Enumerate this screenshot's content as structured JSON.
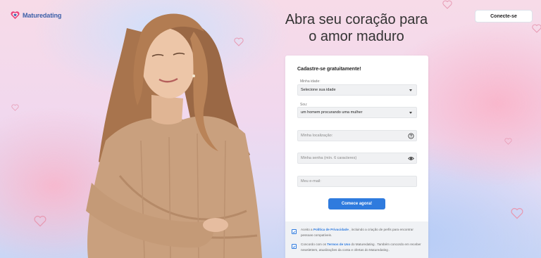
{
  "brand": {
    "name": "Maturedating",
    "accent": "#2f7bde",
    "logo_color": "#3b5fa8"
  },
  "header": {
    "login_label": "Conecte-se"
  },
  "hero": {
    "heading_line1": "Abra seu coração para",
    "heading_line2": "o amor maduro"
  },
  "form": {
    "title": "Cadastre-se gratuitamente!",
    "age": {
      "label": "Minha idade:",
      "value": "Selecione sua idade"
    },
    "seeking": {
      "label": "Sou:",
      "value": "um homem procurando uma mulher"
    },
    "location": {
      "placeholder": "Minha localização:",
      "icon": "help-circle-icon"
    },
    "password": {
      "placeholder": "Minha senha (mín. 6 caracteres)",
      "icon": "eye-icon"
    },
    "email": {
      "placeholder": "Meu e-mail:"
    },
    "submit_label": "Comece agora!"
  },
  "consents": [
    {
      "pre": "Aceito a ",
      "link": "Política de Privacidade",
      "post": " , incluindo a criação de perfis para encontrar pessoas compatíveis.",
      "checked": true
    },
    {
      "pre": "Concordo com os ",
      "link": "Termos de Uso",
      "post": " do Maturedating . Também concordo em receber newsletters, atualizações da conta e ofertas do Maturedating .",
      "checked": true
    }
  ]
}
